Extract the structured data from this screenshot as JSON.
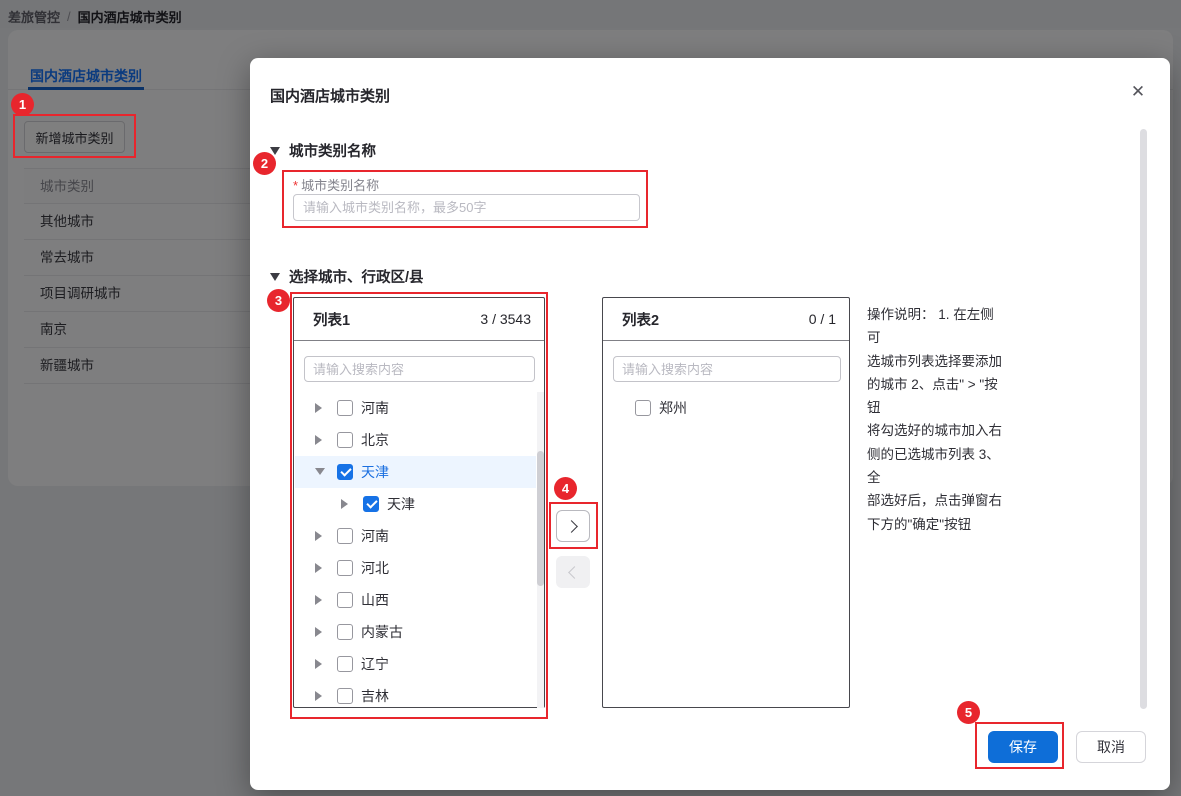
{
  "page": {
    "breadcrumb": {
      "items": [
        "差旅管控",
        "国内酒店城市类别"
      ],
      "separator": "/"
    },
    "tab_label": "国内酒店城市类别",
    "add_button_label": "新增城市类别",
    "table": {
      "header": "城市类别",
      "rows": [
        "其他城市",
        "常去城市",
        "项目调研城市",
        "南京",
        "新疆城市"
      ]
    }
  },
  "modal": {
    "title": "国内酒店城市类别",
    "close_icon": "✕",
    "name_section": {
      "title": "城市类别名称",
      "required_mark": "*",
      "field_label": "城市类别名称",
      "input_value": "",
      "input_placeholder": "请输入城市类别名称，最多50字"
    },
    "city_section": {
      "title": "选择城市、行政区/县"
    },
    "transfer": {
      "left": {
        "title": "列表1",
        "count": "3 / 3543",
        "search_placeholder": "请输入搜索内容",
        "items": [
          {
            "label": "河南",
            "checked": false,
            "expanded": false,
            "level": 0
          },
          {
            "label": "北京",
            "checked": false,
            "expanded": false,
            "level": 0
          },
          {
            "label": "天津",
            "checked": true,
            "expanded": true,
            "selected": true,
            "level": 0
          },
          {
            "label": "天津",
            "checked": true,
            "expanded": false,
            "level": 1
          },
          {
            "label": "河南",
            "checked": false,
            "expanded": false,
            "level": 0
          },
          {
            "label": "河北",
            "checked": false,
            "expanded": false,
            "level": 0
          },
          {
            "label": "山西",
            "checked": false,
            "expanded": false,
            "level": 0
          },
          {
            "label": "内蒙古",
            "checked": false,
            "expanded": false,
            "level": 0
          },
          {
            "label": "辽宁",
            "checked": false,
            "expanded": false,
            "level": 0
          },
          {
            "label": "吉林",
            "checked": false,
            "expanded": false,
            "level": 0
          }
        ]
      },
      "right": {
        "title": "列表2",
        "count": "0 / 1",
        "search_placeholder": "请输入搜索内容",
        "items": [
          {
            "label": "郑州",
            "checked": false
          }
        ]
      }
    },
    "instructions": "操作说明： 1. 在左侧可\n选城市列表选择要添加\n的城市 2、点击\" > \"按钮\n将勾选好的城市加入右\n侧的已选城市列表 3、全\n部选好后，点击弹窗右\n下方的\"确定\"按钮",
    "footer": {
      "save_label": "保存",
      "cancel_label": "取消"
    }
  },
  "annotations": {
    "badges": [
      "1",
      "2",
      "3",
      "4",
      "5"
    ]
  },
  "colors": {
    "accent_blue": "#1677ff",
    "primary_button_blue": "#0e6ed8",
    "selected_row_blue": "#edf5ff",
    "annotation_red": "#e8262d",
    "overlay": "rgba(0,0,0,0.5)"
  }
}
